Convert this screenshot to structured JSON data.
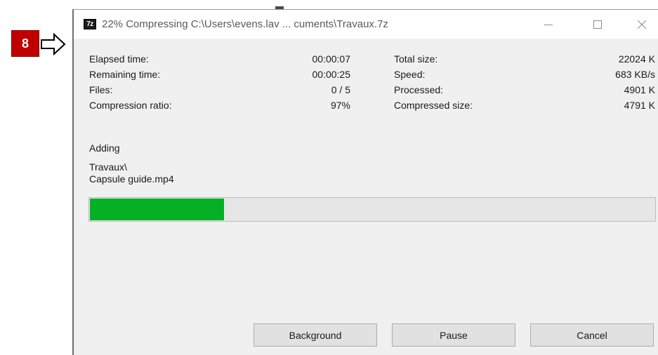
{
  "annotation": {
    "step_number": "8"
  },
  "window": {
    "app_icon_text": "7z",
    "title": "22% Compressing C:\\Users\\evens.lav ... cuments\\Travaux.7z",
    "controls": {
      "minimize_icon": "minimize-icon",
      "maximize_icon": "maximize-icon",
      "close_icon": "close-icon"
    }
  },
  "stats": {
    "left": [
      {
        "label": "Elapsed time:",
        "value": "00:00:07"
      },
      {
        "label": "Remaining time:",
        "value": "00:00:25"
      },
      {
        "label": "Files:",
        "value": "0 / 5"
      },
      {
        "label": "Compression ratio:",
        "value": "97%"
      }
    ],
    "right": [
      {
        "label": "Total size:",
        "value": "22024 K"
      },
      {
        "label": "Speed:",
        "value": "683 KB/s"
      },
      {
        "label": "Processed:",
        "value": "4901 K"
      },
      {
        "label": "Compressed size:",
        "value": "4791 K"
      }
    ]
  },
  "activity": {
    "label": "Adding",
    "path_lines": [
      "Travaux\\",
      "Capsule guide.mp4"
    ]
  },
  "progress": {
    "fraction": 0.22,
    "color": "#06b025"
  },
  "buttons": {
    "background": "Background",
    "pause": "Pause",
    "cancel": "Cancel"
  }
}
